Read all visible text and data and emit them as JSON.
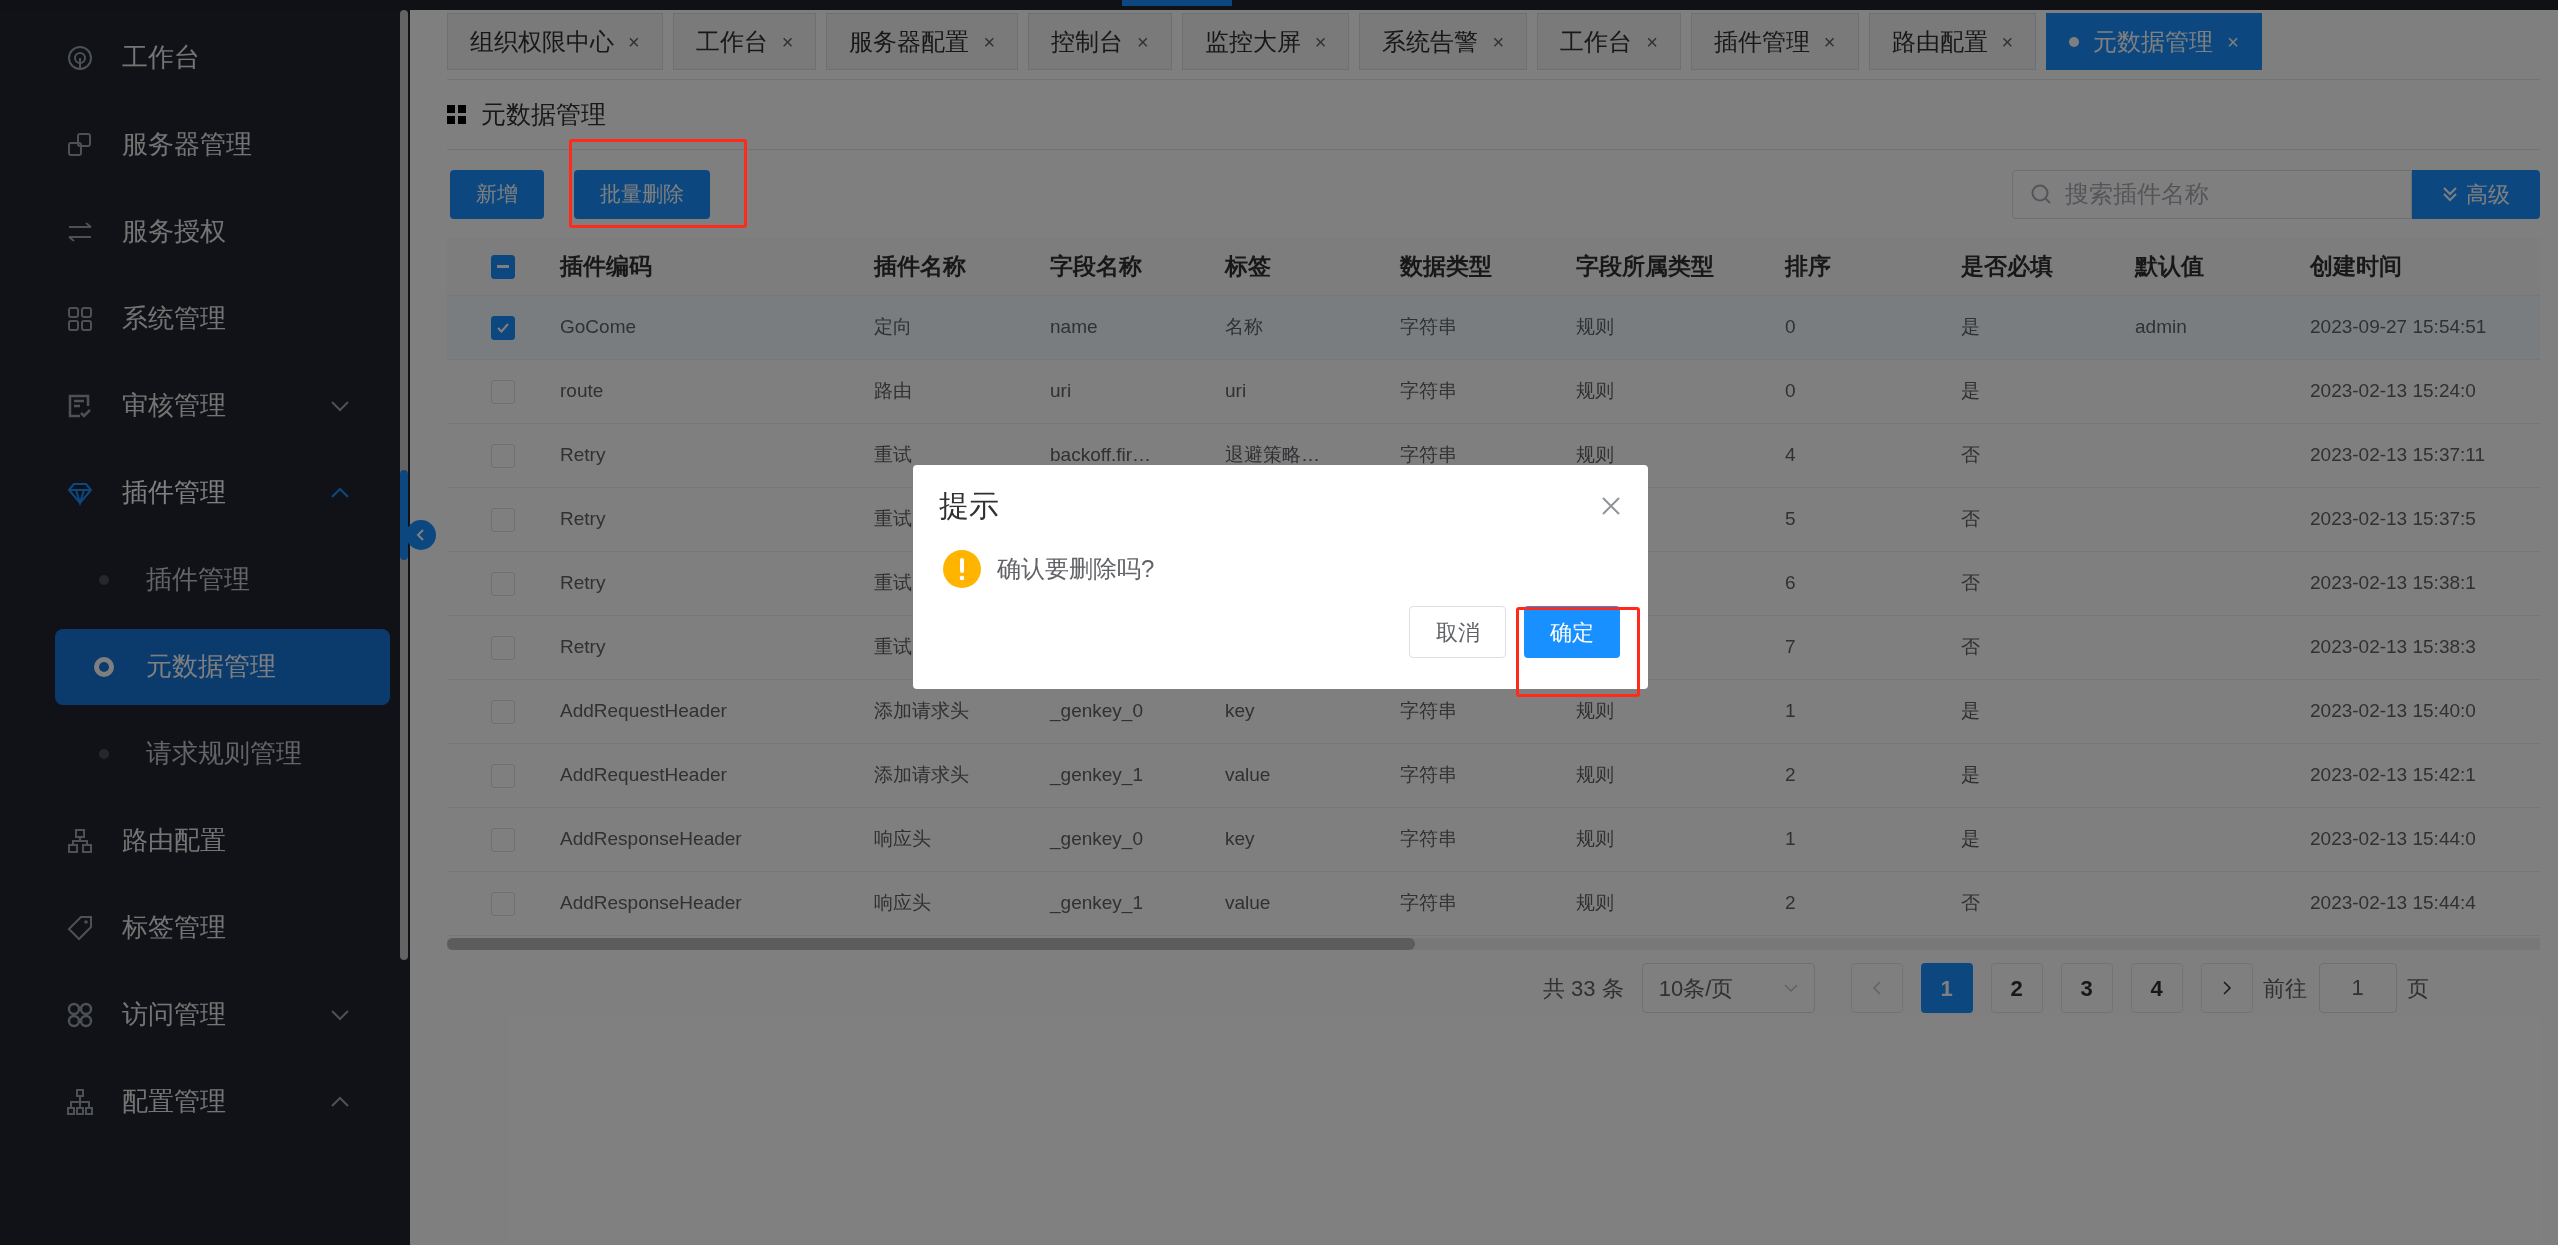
{
  "sidebar": {
    "items": [
      {
        "label": "工作台",
        "selected": false
      },
      {
        "label": "服务器管理",
        "selected": false
      },
      {
        "label": "服务授权",
        "selected": false
      },
      {
        "label": "系统管理",
        "selected": false
      },
      {
        "label": "审核管理",
        "selected": false,
        "expanded": false
      },
      {
        "label": "插件管理",
        "selected": true,
        "expanded": true,
        "children": [
          {
            "label": "插件管理",
            "selected": false
          },
          {
            "label": "元数据管理",
            "selected": true
          },
          {
            "label": "请求规则管理",
            "selected": false
          }
        ]
      },
      {
        "label": "路由配置",
        "selected": false
      },
      {
        "label": "标签管理",
        "selected": false
      },
      {
        "label": "访问管理",
        "selected": false,
        "expanded": false
      },
      {
        "label": "配置管理",
        "selected": false,
        "expanded": true
      }
    ]
  },
  "tabs": [
    {
      "label": "组织权限中心",
      "close": "×",
      "selected": false
    },
    {
      "label": "工作台",
      "close": "×",
      "selected": false
    },
    {
      "label": "服务器配置",
      "close": "×",
      "selected": false
    },
    {
      "label": "控制台",
      "close": "×",
      "selected": false
    },
    {
      "label": "监控大屏",
      "close": "×",
      "selected": false
    },
    {
      "label": "系统告警",
      "close": "×",
      "selected": false
    },
    {
      "label": "工作台",
      "close": "×",
      "selected": false
    },
    {
      "label": "插件管理",
      "close": "×",
      "selected": false
    },
    {
      "label": "路由配置",
      "close": "×",
      "selected": false
    },
    {
      "label": "元数据管理",
      "close": "×",
      "selected": true
    }
  ],
  "page_title": "元数据管理",
  "toolbar": {
    "buttons": [
      "新增",
      "批量删除"
    ],
    "search": {
      "placeholder": "搜索插件名称"
    },
    "advanced_button": "高级"
  },
  "table": {
    "select_all": {
      "indeterminate": true
    },
    "columns": [
      "插件编码",
      "插件名称",
      "字段名称",
      "标签",
      "数据类型",
      "字段所属类型",
      "排序",
      "是否必填",
      "默认值",
      "创建时间"
    ],
    "rows": [
      {
        "checked": true,
        "cells": [
          "GoCome",
          "定向",
          "name",
          "名称",
          "字符串",
          "规则",
          "0",
          "是",
          "admin",
          "2023-09-27 15:54:51"
        ]
      },
      {
        "checked": false,
        "cells": [
          "route",
          "路由",
          "uri",
          "uri",
          "字符串",
          "规则",
          "0",
          "是",
          null,
          "2023-02-13 15:24:0"
        ]
      },
      {
        "checked": false,
        "cells": [
          "Retry",
          "重试",
          "backoff.fir…",
          "退避策略…",
          "字符串",
          "规则",
          "4",
          "否",
          null,
          "2023-02-13 15:37:11"
        ]
      },
      {
        "checked": false,
        "cells": [
          "Retry",
          "重试",
          null,
          null,
          null,
          null,
          "5",
          "否",
          null,
          "2023-02-13 15:37:5"
        ]
      },
      {
        "checked": false,
        "cells": [
          "Retry",
          "重试",
          null,
          null,
          null,
          null,
          "6",
          "否",
          null,
          "2023-02-13 15:38:1"
        ]
      },
      {
        "checked": false,
        "cells": [
          "Retry",
          "重试",
          null,
          null,
          null,
          null,
          "7",
          "否",
          null,
          "2023-02-13 15:38:3"
        ]
      },
      {
        "checked": false,
        "cells": [
          "AddRequestHeader",
          "添加请求头",
          "_genkey_0",
          "key",
          "字符串",
          "规则",
          "1",
          "是",
          null,
          "2023-02-13 15:40:0"
        ]
      },
      {
        "checked": false,
        "cells": [
          "AddRequestHeader",
          "添加请求头",
          "_genkey_1",
          "value",
          "字符串",
          "规则",
          "2",
          "是",
          null,
          "2023-02-13 15:42:1"
        ]
      },
      {
        "checked": false,
        "cells": [
          "AddResponseHeader",
          "响应头",
          "_genkey_0",
          "key",
          "字符串",
          "规则",
          "1",
          "是",
          null,
          "2023-02-13 15:44:0"
        ]
      },
      {
        "checked": false,
        "cells": [
          "AddResponseHeader",
          "响应头",
          "_genkey_1",
          "value",
          "字符串",
          "规则",
          "2",
          "否",
          null,
          "2023-02-13 15:44:4"
        ]
      }
    ]
  },
  "pagination": {
    "total": "共 33 条",
    "page_size": "10条/页",
    "pages": [
      {
        "label": "1",
        "selected": true
      },
      {
        "label": "2",
        "selected": false
      },
      {
        "label": "3",
        "selected": false
      },
      {
        "label": "4",
        "selected": false
      }
    ],
    "goto_label": "前往",
    "goto_value": "1",
    "page_unit": "页"
  },
  "dialog": {
    "title": "提示",
    "message": "确认要删除吗?",
    "cancel": "取消",
    "confirm": "确定"
  }
}
